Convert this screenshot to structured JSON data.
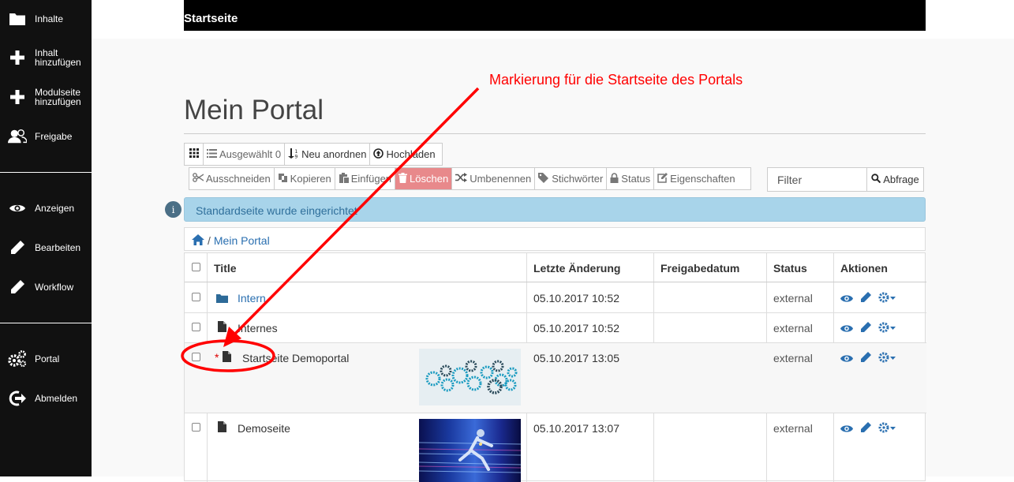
{
  "sidebar": {
    "items": [
      {
        "label": "Inhalte",
        "icon": "folder-icon"
      },
      {
        "label": "Inhalt hinzufügen",
        "icon": "plus-icon"
      },
      {
        "label": "Modulseite hinzufügen",
        "icon": "plus-icon"
      },
      {
        "label": "Freigabe",
        "icon": "users-icon"
      },
      {
        "label": "Anzeigen",
        "icon": "eye-icon"
      },
      {
        "label": "Bearbeiten",
        "icon": "pencil-icon"
      },
      {
        "label": "Workflow",
        "icon": "pencil-icon"
      },
      {
        "label": "Portal",
        "icon": "gears-icon"
      },
      {
        "label": "Abmelden",
        "icon": "logout-icon"
      }
    ]
  },
  "topbar": {
    "title": "Startseite"
  },
  "page": {
    "title": "Mein Portal"
  },
  "toolbar1": {
    "selected": "Ausgewählt 0",
    "reorder": "Neu anordnen",
    "upload": "Hochladen"
  },
  "toolbar2": {
    "cut": "Ausschneiden",
    "copy": "Kopieren",
    "paste": "Einfügen",
    "delete": "Löschen",
    "rename": "Umbenennen",
    "tags": "Stichwörter",
    "status": "Status",
    "properties": "Eigenschaften"
  },
  "filter": {
    "placeholder": "Filter",
    "button": "Abfrage"
  },
  "info": {
    "message": "Standardseite wurde eingerichtet"
  },
  "breadcrumb": {
    "separator": "/",
    "current": "Mein Portal"
  },
  "table": {
    "headers": {
      "title": "Title",
      "modified": "Letzte Änderung",
      "published": "Freigabedatum",
      "status": "Status",
      "actions": "Aktionen"
    },
    "rows": [
      {
        "title": "Intern",
        "type": "folder",
        "modified": "05.10.2017 10:52",
        "published": "",
        "status": "external"
      },
      {
        "title": "Internes",
        "type": "document",
        "modified": "05.10.2017 10:52",
        "published": "",
        "status": "external"
      },
      {
        "title": "Startseite Demoportal",
        "type": "document",
        "marker": "*",
        "modified": "05.10.2017 13:05",
        "published": "",
        "status": "external"
      },
      {
        "title": "Demoseite",
        "type": "document",
        "modified": "05.10.2017 13:07",
        "published": "",
        "status": "external"
      }
    ]
  },
  "annotation": {
    "text": "Markierung für die Startseite des Portals"
  },
  "colors": {
    "annotation": "#ff0000",
    "link": "#2a6fb0",
    "danger": "#e8898b",
    "info": "#a8d4ea"
  }
}
